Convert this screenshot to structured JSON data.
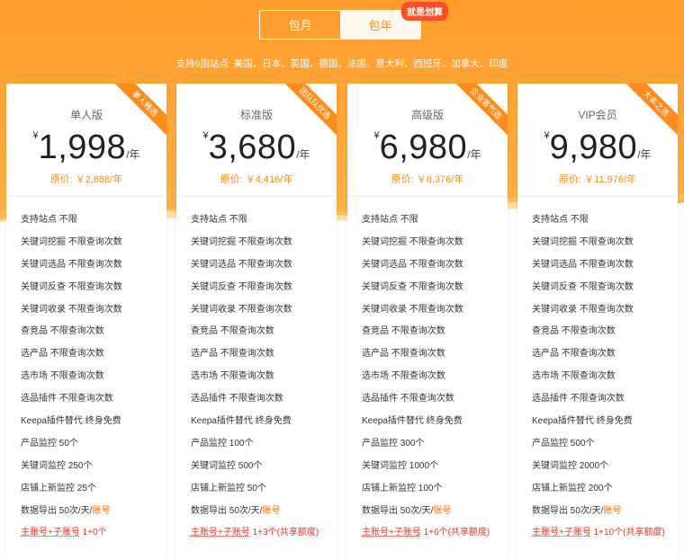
{
  "toggle": {
    "monthly": "包月",
    "yearly": "包年",
    "badge": "就是划算"
  },
  "sites_text": "支持9国站点: 美国、日本、英国、德国、法国、意大利、西班牙、加拿大、印度",
  "currency": "¥",
  "per_year": "/年",
  "colors": {
    "accent": "#ff8c1a",
    "hero": "#ffa23a",
    "red": "#e5342b"
  },
  "plans": [
    {
      "name": "单人版",
      "ribbon": "单人畅选",
      "price": "1,998",
      "original": "原价: ￥2,688/年",
      "features": {
        "sites": "支持站点 不限",
        "kw_mining": "关键词挖掘 不限查询次数",
        "kw_select": "关键词选品 不限查询次数",
        "kw_reverse": "关键词反查 不限查询次数",
        "kw_collect": "关键词收录 不限查询次数",
        "competitor": "查竞品 不限查询次数",
        "product_select": "选产品 不限查询次数",
        "market_select": "选市场 不限查询次数",
        "plugin": "选品插件 不限查询次数",
        "keepa": "Keepa插件替代 终身免费",
        "product_monitor": "产品监控 50个",
        "kw_monitor": "关键词监控 250个",
        "store_monitor": "店铺上新监控 25个",
        "export_prefix": "数据导出 50次/天/",
        "export_suffix": "账号",
        "account_prefix": "主账号+子账号",
        "account_suffix": " 1+0个"
      }
    },
    {
      "name": "标准版",
      "ribbon": "团队队优选",
      "price": "3,680",
      "original": "原价: ￥4,416/年",
      "features": {
        "sites": "支持站点 不限",
        "kw_mining": "关键词挖掘 不限查询次数",
        "kw_select": "关键词选品 不限查询次数",
        "kw_reverse": "关键词反查 不限查询次数",
        "kw_collect": "关键词收录 不限查询次数",
        "competitor": "查竞品 不限查询次数",
        "product_select": "选产品 不限查询次数",
        "market_select": "选市场 不限查询次数",
        "plugin": "选品插件 不限查询次数",
        "keepa": "Keepa插件替代 终身免费",
        "product_monitor": "产品监控 100个",
        "kw_monitor": "关键词监控 500个",
        "store_monitor": "店铺上新监控 50个",
        "export_prefix": "数据导出 50次/天/",
        "export_suffix": "账号",
        "account_prefix": "主账号+子账号",
        "account_suffix": " 1+3个(共享额度)"
      }
    },
    {
      "name": "高级版",
      "ribbon": "企业客气选",
      "price": "6,980",
      "original": "原价: ￥8,376/年",
      "features": {
        "sites": "支持站点 不限",
        "kw_mining": "关键词挖掘 不限查询次数",
        "kw_select": "关键词选品 不限查询次数",
        "kw_reverse": "关键词反查 不限查询次数",
        "kw_collect": "关键词收录 不限查询次数",
        "competitor": "查竞品 不限查询次数",
        "product_select": "选产品 不限查询次数",
        "market_select": "选市场 不限查询次数",
        "plugin": "选品插件 不限查询次数",
        "keepa": "Keepa插件替代 终身免费",
        "product_monitor": "产品监控 300个",
        "kw_monitor": "关键词监控 1000个",
        "store_monitor": "店铺上新监控 100个",
        "export_prefix": "数据导出 50次/天/",
        "export_suffix": "账号",
        "account_prefix": "主账号+子账号",
        "account_suffix": " 1+6个(共享额度)"
      }
    },
    {
      "name": "VIP会员",
      "ribbon": "大卖之选",
      "price": "9,980",
      "original": "原价: ￥11,976/年",
      "features": {
        "sites": "支持站点 不限",
        "kw_mining": "关键词挖掘 不限查询次数",
        "kw_select": "关键词选品 不限查询次数",
        "kw_reverse": "关键词反查 不限查询次数",
        "kw_collect": "关键词收录 不限查询次数",
        "competitor": "查竞品 不限查询次数",
        "product_select": "选产品 不限查询次数",
        "market_select": "选市场 不限查询次数",
        "plugin": "选品插件 不限查询次数",
        "keepa": "Keepa插件替代 终身免费",
        "product_monitor": "产品监控 500个",
        "kw_monitor": "关键词监控 2000个",
        "store_monitor": "店铺上新监控 200个",
        "export_prefix": "数据导出 50次/天/",
        "export_suffix": "账号",
        "account_prefix": "主账号+子账号",
        "account_suffix": " 1+10个(共享额度)"
      }
    }
  ]
}
